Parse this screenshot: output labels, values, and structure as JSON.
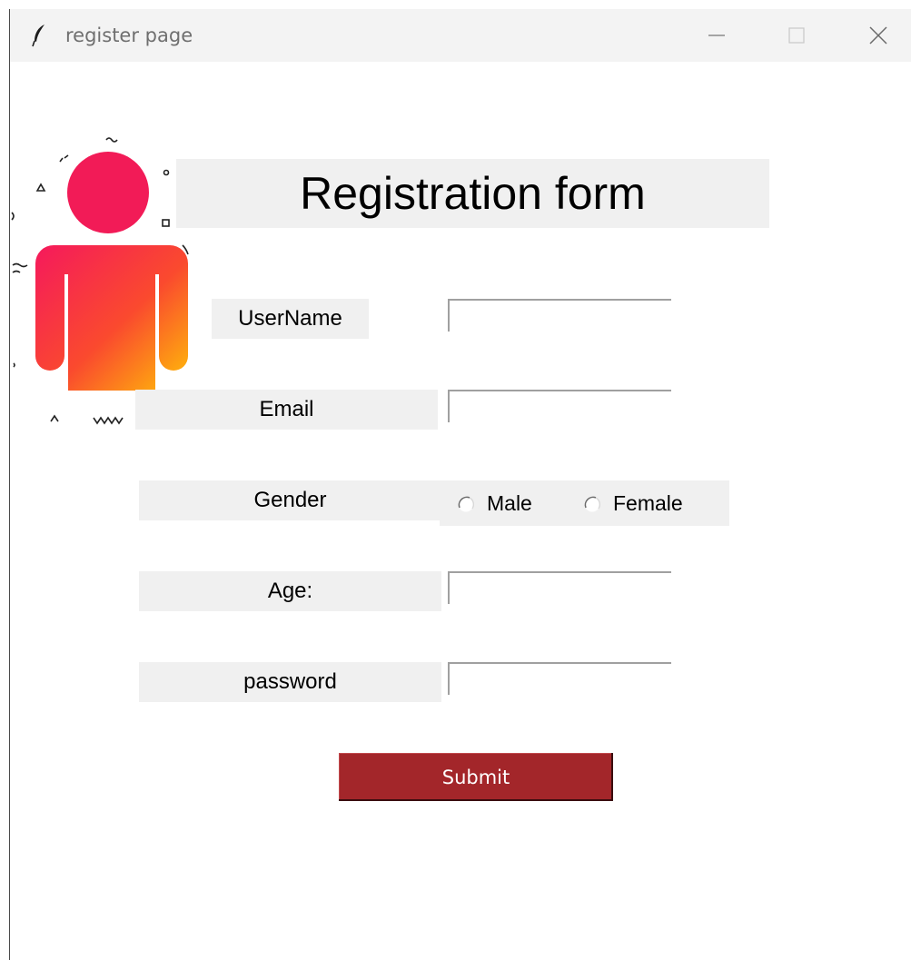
{
  "window": {
    "title": "register page",
    "icon": "feather-icon",
    "controls": [
      "minimize-icon",
      "maximize-icon",
      "close-icon"
    ]
  },
  "form": {
    "heading": "Registration form",
    "image_icon": "person-icon",
    "fields": {
      "username_label": "UserName",
      "username_value": "",
      "email_label": "Email",
      "email_value": "",
      "gender_label": "Gender",
      "gender_options": [
        "Male",
        "Female"
      ],
      "gender_selected": "",
      "age_label": "Age:",
      "age_value": "",
      "password_label": "password",
      "password_value": ""
    },
    "submit_label": "Submit"
  },
  "colors": {
    "submit_background": "#a3262a",
    "label_background": "#f0f0f0",
    "person_gradient_top": "#f5195c",
    "person_gradient_bottom": "#ffc107"
  }
}
